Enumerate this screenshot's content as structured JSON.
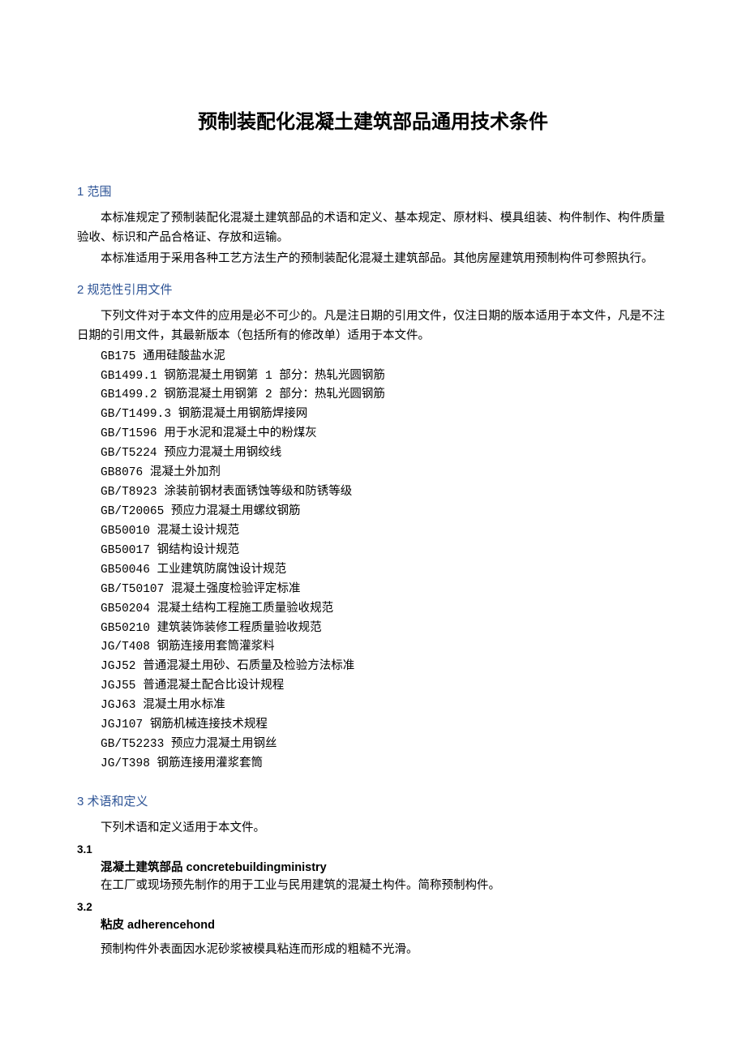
{
  "title": "预制装配化混凝土建筑部品通用技术条件",
  "sections": {
    "s1": {
      "heading": "1 范围",
      "p1": "本标准规定了预制装配化混凝土建筑部品的术语和定义、基本规定、原材料、模具组装、构件制作、构件质量验收、标识和产品合格证、存放和运输。",
      "p2": "本标准适用于采用各种工艺方法生产的预制装配化混凝土建筑部品。其他房屋建筑用预制构件可参照执行。"
    },
    "s2": {
      "heading": "2 规范性引用文件",
      "p1": "下列文件对于本文件的应用是必不可少的。凡是注日期的引用文件，仅注日期的版本适用于本文件，凡是不注日期的引用文件，其最新版本（包括所有的修改单）适用于本文件。",
      "refs": [
        "GB175 通用硅酸盐水泥",
        "GB1499.1 钢筋混凝土用钢第 1 部分：热轧光圆钢筋",
        "GB1499.2 钢筋混凝土用钢第 2 部分：热轧光圆钢筋",
        "GB/T1499.3 钢筋混凝土用钢筋焊接网",
        "GB/T1596 用于水泥和混凝土中的粉煤灰",
        "GB/T5224 预应力混凝土用钢绞线",
        "GB8076 混凝土外加剂",
        "GB/T8923 涂装前钢材表面锈蚀等级和防锈等级",
        "GB/T20065 预应力混凝土用螺纹钢筋",
        "GB50010 混凝土设计规范",
        "GB50017 钢结构设计规范",
        "GB50046 工业建筑防腐蚀设计规范",
        "GB/T50107 混凝土强度检验评定标准",
        "GB50204 混凝土结构工程施工质量验收规范",
        "GB50210 建筑装饰装修工程质量验收规范",
        "JG/T408 钢筋连接用套筒灌浆料",
        "JGJ52 普通混凝土用砂、石质量及检验方法标准",
        "JGJ55 普通混凝土配合比设计规程",
        "JGJ63 混凝土用水标准",
        "JGJ107 钢筋机械连接技术规程",
        "GB/T52233 预应力混凝土用钢丝",
        "JG/T398 钢筋连接用灌浆套筒"
      ]
    },
    "s3": {
      "heading": "3 术语和定义",
      "p1": "下列术语和定义适用于本文件。",
      "t1": {
        "num": "3.1",
        "title": "混凝土建筑部品 concretebuildingministry",
        "desc": "在工厂或现场预先制作的用于工业与民用建筑的混凝土构件。简称预制构件。"
      },
      "t2": {
        "num": "3.2",
        "title": "粘皮 adherencehond",
        "desc": "预制构件外表面因水泥砂浆被模具粘连而形成的粗糙不光滑。"
      }
    }
  }
}
